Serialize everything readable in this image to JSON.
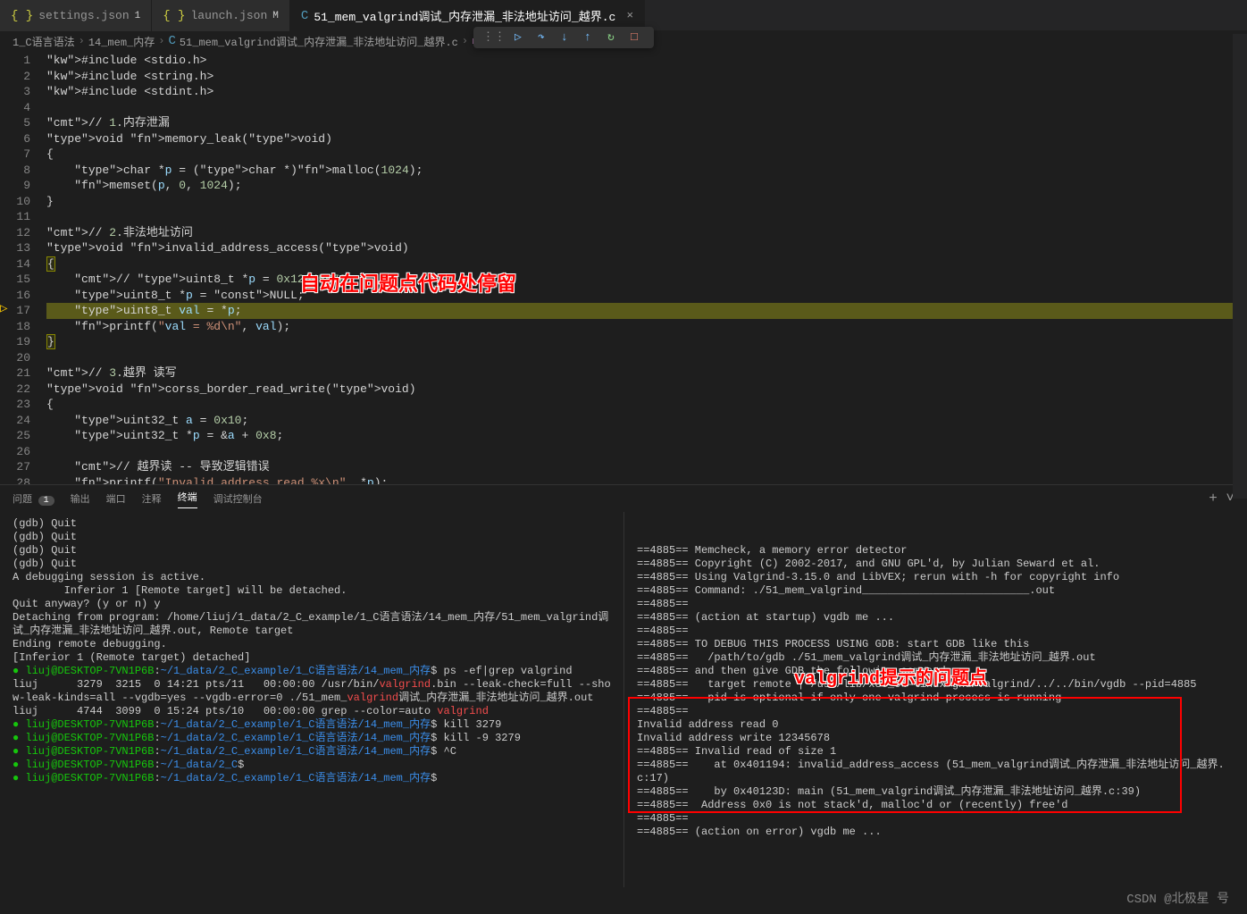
{
  "tabs": [
    {
      "icon": "{ }",
      "label": "settings.json",
      "marker": "1",
      "iconClass": "json"
    },
    {
      "icon": "{ }",
      "label": "launch.json",
      "marker": "M",
      "iconClass": "json"
    },
    {
      "icon": "C",
      "label": "51_mem_valgrind调试_内存泄漏_非法地址访问_越界.c",
      "marker": "×",
      "iconClass": "c",
      "active": true
    }
  ],
  "breadcrumb": {
    "parts": [
      "1_C语言语法",
      "14_mem_内存",
      "51_mem_valgrind调试_内存泄漏_非法地址访问_越界.c",
      "..."
    ]
  },
  "annotation_top": "自动在问题点代码处停留",
  "annotation_right": "valgrind提示的问题点",
  "code_lines": [
    {
      "n": 1,
      "raw": "#include <stdio.h>"
    },
    {
      "n": 2,
      "raw": "#include <string.h>"
    },
    {
      "n": 3,
      "raw": "#include <stdint.h>"
    },
    {
      "n": 4,
      "raw": ""
    },
    {
      "n": 5,
      "raw": "// 1.内存泄漏"
    },
    {
      "n": 6,
      "raw": "void memory_leak(void)"
    },
    {
      "n": 7,
      "raw": "{"
    },
    {
      "n": 8,
      "raw": "    char *p = (char *)malloc(1024);"
    },
    {
      "n": 9,
      "raw": "    memset(p, 0, 1024);"
    },
    {
      "n": 10,
      "raw": "}"
    },
    {
      "n": 11,
      "raw": ""
    },
    {
      "n": 12,
      "raw": "// 2.非法地址访问"
    },
    {
      "n": 13,
      "raw": "void invalid_address_access(void)"
    },
    {
      "n": 14,
      "raw": "{"
    },
    {
      "n": 15,
      "raw": "    // uint8_t *p = 0x12345678;"
    },
    {
      "n": 16,
      "raw": "    uint8_t *p = NULL;"
    },
    {
      "n": 17,
      "raw": "    uint8_t val = *p;"
    },
    {
      "n": 18,
      "raw": "    printf(\"val = %d\\n\", val);"
    },
    {
      "n": 19,
      "raw": "}"
    },
    {
      "n": 20,
      "raw": ""
    },
    {
      "n": 21,
      "raw": "// 3.越界 读写"
    },
    {
      "n": 22,
      "raw": "void corss_border_read_write(void)"
    },
    {
      "n": 23,
      "raw": "{"
    },
    {
      "n": 24,
      "raw": "    uint32_t a = 0x10;"
    },
    {
      "n": 25,
      "raw": "    uint32_t *p = &a + 0x8;"
    },
    {
      "n": 26,
      "raw": ""
    },
    {
      "n": 27,
      "raw": "    // 越界读 -- 导致逻辑错误"
    },
    {
      "n": 28,
      "raw": "    printf(\"Invalid address read %x\\n\", *p);"
    }
  ],
  "panel_tabs": {
    "problems": "问题",
    "problems_count": "1",
    "output": "输出",
    "ports": "端口",
    "comments": "注释",
    "terminal": "终端",
    "debug_console": "调试控制台"
  },
  "term_left": [
    {
      "t": "(gdb) Quit",
      "c": "t-white"
    },
    {
      "t": "(gdb) Quit",
      "c": "t-white"
    },
    {
      "t": "(gdb) Quit",
      "c": "t-white"
    },
    {
      "t": "(gdb) Quit",
      "c": "t-white"
    },
    {
      "t": "A debugging session is active.",
      "c": "t-white"
    },
    {
      "t": "",
      "c": "t-white"
    },
    {
      "t": "        Inferior 1 [Remote target] will be detached.",
      "c": "t-white"
    },
    {
      "t": "",
      "c": "t-white"
    },
    {
      "t": "Quit anyway? (y or n) y",
      "c": "t-white"
    },
    {
      "t": "Detaching from program: /home/liuj/1_data/2_C_example/1_C语言语法/14_mem_内存/51_mem_valgrind调试_内存泄漏_非法地址访问_越界.out, Remote target",
      "c": "t-white"
    },
    {
      "t": "Ending remote debugging.",
      "c": "t-white"
    },
    {
      "t": "[Inferior 1 (Remote target) detached]",
      "c": "t-white"
    }
  ],
  "term_left_prompts": [
    {
      "user": "liuj@DESKTOP-7VN1P6B",
      "path": "~/1_data/2_C_example/1_C语言语法/14_mem_内存",
      "cmd": "ps -ef|grep valgrind"
    },
    {
      "plain": "liuj      3279  3215  0 14:21 pts/11   00:00:00 /usr/bin/",
      "red": "valgrind",
      "rest": ".bin --leak-check=full --show-leak-kinds=all --vgdb=yes --vgdb-error=0 ./51_mem_",
      "red2": "valgrind",
      "rest2": "调试_内存泄漏_非法地址访问_越界.out"
    },
    {
      "plain": "liuj      4744  3099  0 15:24 pts/10   00:00:00 grep --color=auto ",
      "red": "valgrind"
    },
    {
      "user": "liuj@DESKTOP-7VN1P6B",
      "path": "~/1_data/2_C_example/1_C语言语法/14_mem_内存",
      "cmd": "kill 3279"
    },
    {
      "user": "liuj@DESKTOP-7VN1P6B",
      "path": "~/1_data/2_C_example/1_C语言语法/14_mem_内存",
      "cmd": "kill -9 3279"
    },
    {
      "user": "liuj@DESKTOP-7VN1P6B",
      "path": "~/1_data/2_C_example/1_C语言语法/14_mem_内存",
      "cmd": "^C"
    },
    {
      "user": "liuj@DESKTOP-7VN1P6B",
      "path": "~/1_data/2_C",
      "cmd": ""
    },
    {
      "user": "liuj@DESKTOP-7VN1P6B",
      "path": "~/1_data/2_C_example/1_C语言语法/14_mem_内存",
      "cmd": ""
    }
  ],
  "term_right": [
    "==4885== Memcheck, a memory error detector",
    "==4885== Copyright (C) 2002-2017, and GNU GPL'd, by Julian Seward et al.",
    "==4885== Using Valgrind-3.15.0 and LibVEX; rerun with -h for copyright info",
    "==4885== Command: ./51_mem_valgrind__________________________.out",
    "==4885==",
    "==4885== (action at startup) vgdb me ...",
    "==4885==",
    "==4885== TO DEBUG THIS PROCESS USING GDB: start GDB like this",
    "==4885==   /path/to/gdb ./51_mem_valgrind调试_内存泄漏_非法地址访问_越界.out",
    "==4885== and then give GDB the following command",
    "==4885==   target remote | /usr/lib/x86_64-linux-gnu/valgrind/../../bin/vgdb --pid=4885",
    "==4885== --pid is optional if only one valgrind process is running",
    "==4885==",
    "Invalid address read 0",
    "Invalid address write 12345678",
    "==4885== Invalid read of size 1",
    "==4885==    at 0x401194: invalid_address_access (51_mem_valgrind调试_内存泄漏_非法地址访问_越界.c:17)",
    "==4885==    by 0x40123D: main (51_mem_valgrind调试_内存泄漏_非法地址访问_越界.c:39)",
    "==4885==  Address 0x0 is not stack'd, malloc'd or (recently) free'd",
    "==4885==",
    "==4885== (action on error) vgdb me ..."
  ],
  "watermark": "CSDN @北极星 号"
}
